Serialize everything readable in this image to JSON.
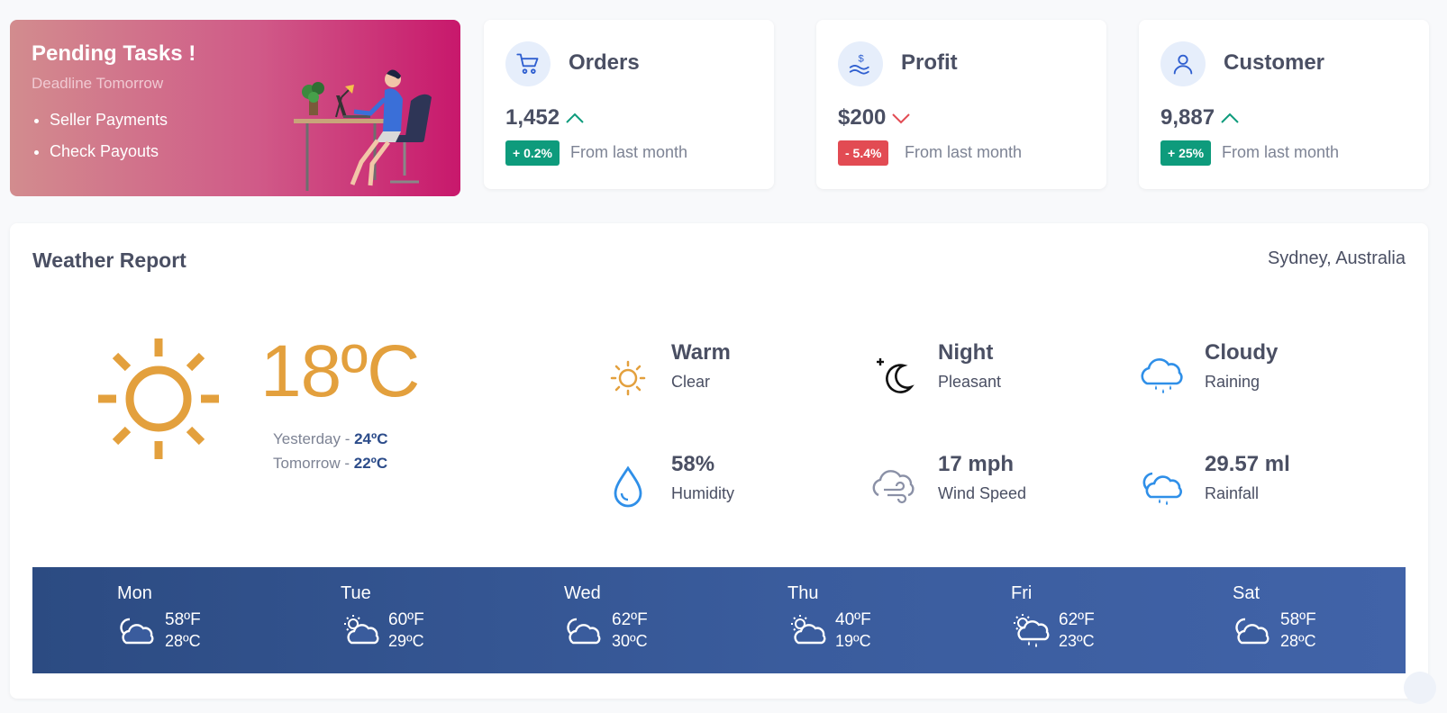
{
  "pending": {
    "title": "Pending Tasks !",
    "subtitle": "Deadline Tomorrow",
    "items": [
      "Seller Payments",
      "Check Payouts"
    ]
  },
  "stats": [
    {
      "title": "Orders",
      "value": "1,452",
      "trend": "up",
      "badge": "+ 0.2%",
      "note": "From last month",
      "icon": "cart-icon"
    },
    {
      "title": "Profit",
      "value": "$200",
      "trend": "down",
      "badge": "- 5.4%",
      "note": "From last month",
      "icon": "money-hand-icon"
    },
    {
      "title": "Customer",
      "value": "9,887",
      "trend": "up",
      "badge": "+ 25%",
      "note": "From last month",
      "icon": "user-icon"
    }
  ],
  "weather": {
    "title": "Weather Report",
    "location": "Sydney, Australia",
    "temperature": "18ºC",
    "yesterday_label": "Yesterday - ",
    "yesterday_value": "24ºC",
    "tomorrow_label": "Tomorrow - ",
    "tomorrow_value": "22ºC",
    "conditions": [
      {
        "main": "Warm",
        "sub": "Clear",
        "icon": "sun-icon"
      },
      {
        "main": "Night",
        "sub": "Pleasant",
        "icon": "moon-icon"
      },
      {
        "main": "Cloudy",
        "sub": "Raining",
        "icon": "rain-cloud-icon"
      },
      {
        "main": "58%",
        "sub": "Humidity",
        "icon": "droplet-icon"
      },
      {
        "main": "17 mph",
        "sub": "Wind Speed",
        "icon": "wind-cloud-icon"
      },
      {
        "main": "29.57 ml",
        "sub": "Rainfall",
        "icon": "night-rain-icon"
      }
    ],
    "forecast": [
      {
        "day": "Mon",
        "f": "58ºF",
        "c": "28ºC",
        "icon": "moon-cloud-icon"
      },
      {
        "day": "Tue",
        "f": "60ºF",
        "c": "29ºC",
        "icon": "sun-cloud-icon"
      },
      {
        "day": "Wed",
        "f": "62ºF",
        "c": "30ºC",
        "icon": "moon-cloud-icon"
      },
      {
        "day": "Thu",
        "f": "40ºF",
        "c": "19ºC",
        "icon": "sun-cloud-icon"
      },
      {
        "day": "Fri",
        "f": "62ºF",
        "c": "23ºC",
        "icon": "sun-rain-icon"
      },
      {
        "day": "Sat",
        "f": "58ºF",
        "c": "28ºC",
        "icon": "moon-cloud-icon"
      }
    ]
  },
  "colors": {
    "accent": "#e3a03d",
    "up": "#0e9b7c",
    "down": "#e24b53",
    "forecast_bg": "#3a5c9d",
    "icon_blue": "#2f8fe8"
  }
}
